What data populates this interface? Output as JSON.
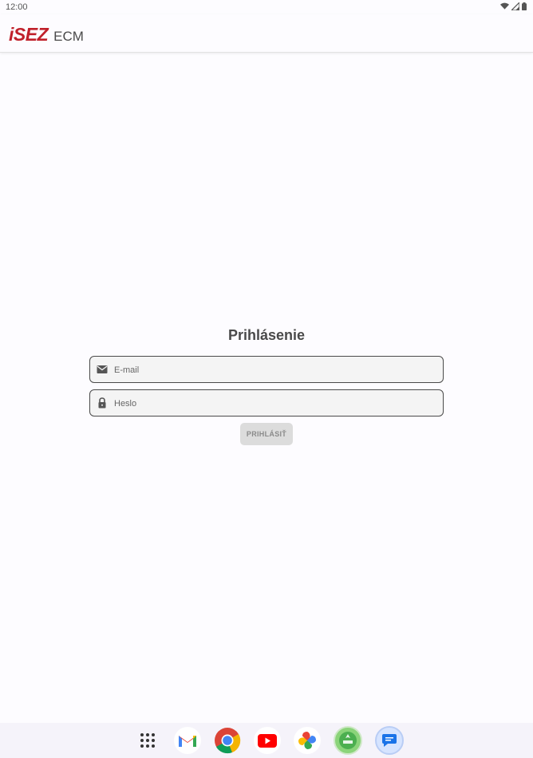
{
  "status_bar": {
    "time": "12:00",
    "icons": [
      "wifi-icon",
      "signal-icon",
      "battery-icon"
    ]
  },
  "app_bar": {
    "logo_mark": "iSEZ",
    "logo_suffix": "ECM",
    "brand_color": "#c0202a"
  },
  "login": {
    "title": "Prihlásenie",
    "email": {
      "placeholder": "E-mail",
      "value": "",
      "icon": "mail-icon"
    },
    "password": {
      "placeholder": "Heslo",
      "value": "",
      "icon": "lock-icon"
    },
    "submit_label": "PRIHLÁSIŤ"
  },
  "dock": {
    "apps": [
      "app-drawer-icon",
      "gmail-icon",
      "chrome-icon",
      "youtube-icon",
      "photos-icon",
      "isez-app-icon",
      "messages-icon"
    ]
  }
}
